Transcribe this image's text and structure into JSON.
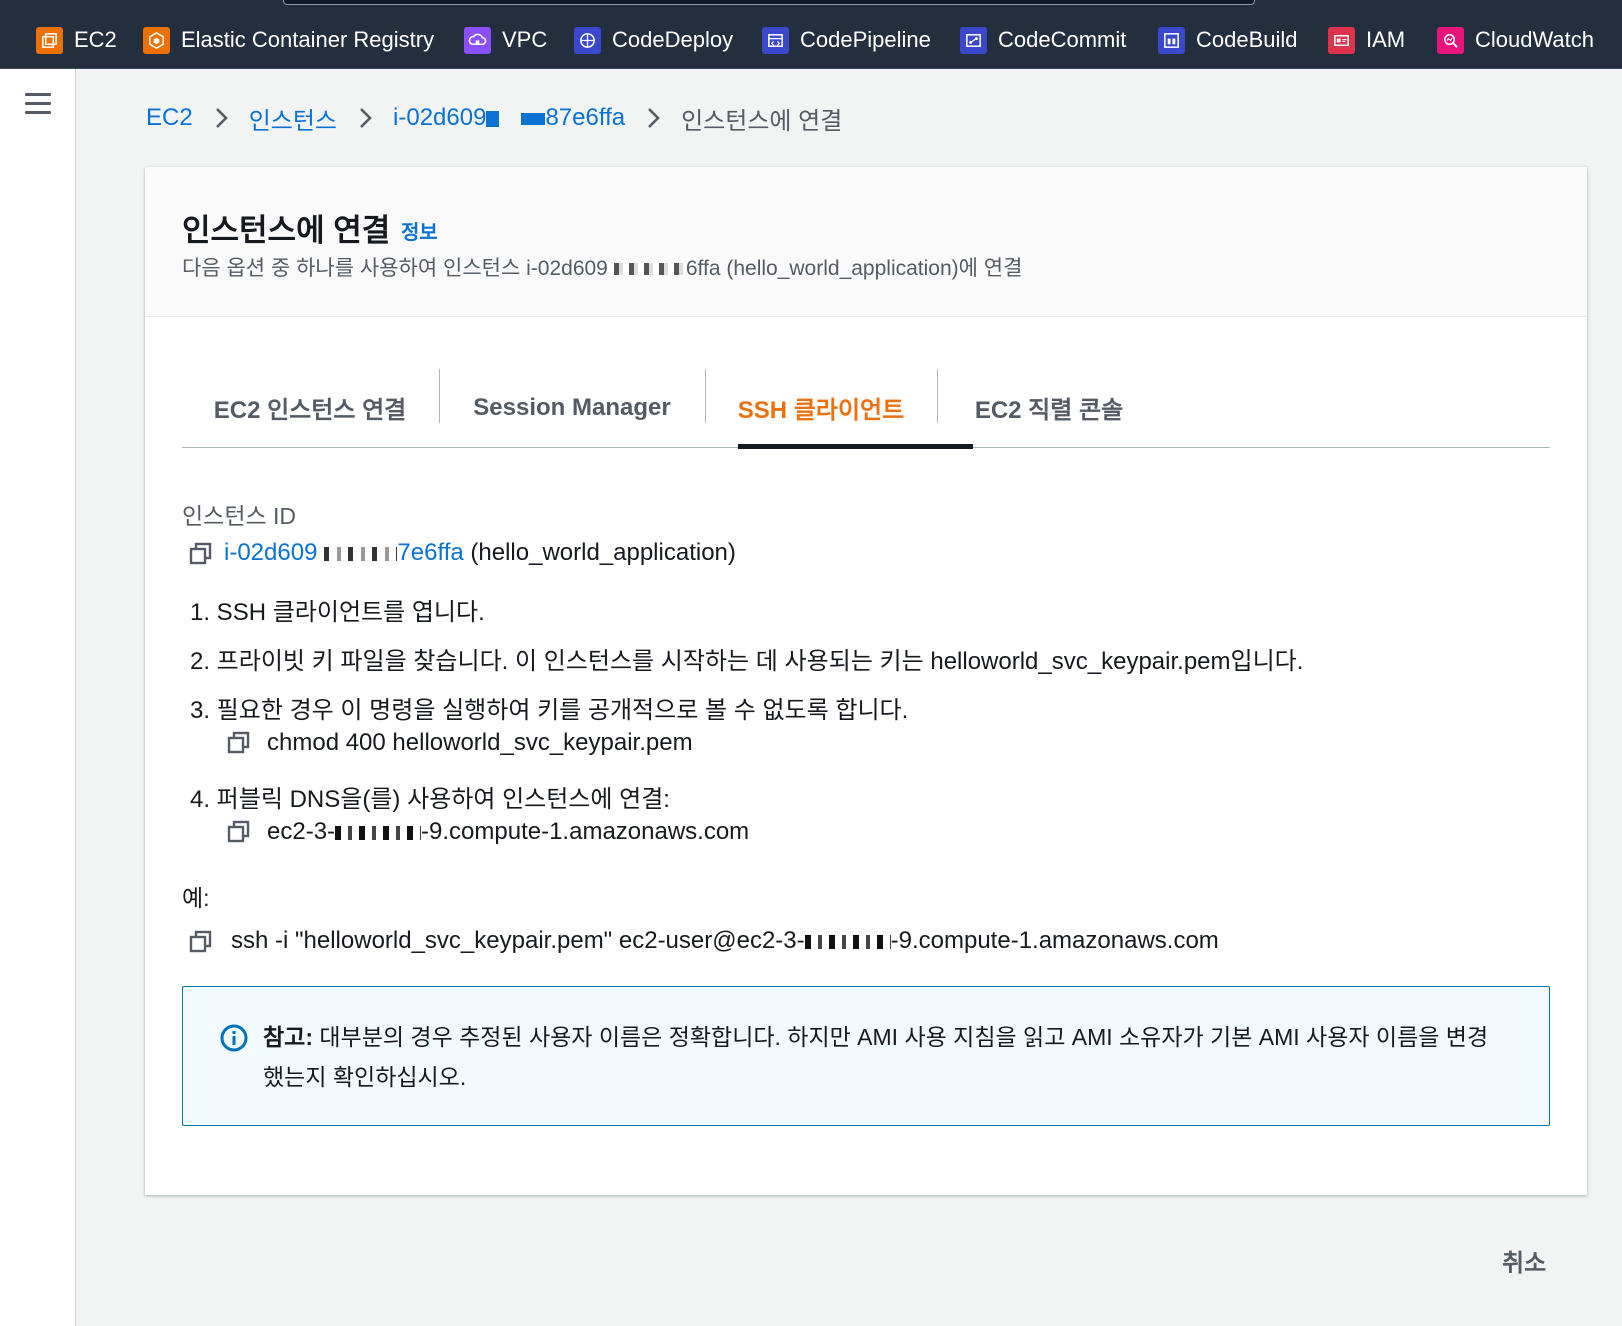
{
  "topbar": {
    "services": [
      {
        "label": "EC2",
        "color": "#ed7100",
        "icon": "ec2-icon"
      },
      {
        "label": "Elastic Container Registry",
        "color": "#ed7100",
        "icon": "container-registry-icon"
      },
      {
        "label": "VPC",
        "color": "#8c4fff",
        "icon": "vpc-icon"
      },
      {
        "label": "CodeDeploy",
        "color": "#3b48cc",
        "icon": "codedeploy-icon"
      },
      {
        "label": "CodePipeline",
        "color": "#3b48cc",
        "icon": "codepipeline-icon"
      },
      {
        "label": "CodeCommit",
        "color": "#3b48cc",
        "icon": "codecommit-icon"
      },
      {
        "label": "CodeBuild",
        "color": "#3b48cc",
        "icon": "codebuild-icon"
      },
      {
        "label": "IAM",
        "color": "#dd344c",
        "icon": "iam-icon"
      },
      {
        "label": "CloudWatch",
        "color": "#e7157b",
        "icon": "cloudwatch-icon"
      }
    ]
  },
  "breadcrumb": {
    "root": "EC2",
    "instances": "인스턴스",
    "instance_id_start": "i-02d609",
    "instance_id_end": "87e6ffa",
    "current": "인스턴스에 연결"
  },
  "header": {
    "title": "인스턴스에 연결",
    "info": "정보",
    "desc_prefix": "다음 옵션 중 하나를 사용하여 인스턴스 i-02d609",
    "desc_suffix": "6ffa (hello_world_application)에 연결"
  },
  "tabs": [
    {
      "label": "EC2 인스턴스 연결",
      "active": false
    },
    {
      "label": "Session Manager",
      "active": false
    },
    {
      "label": "SSH 클라이언트",
      "active": true
    },
    {
      "label": "EC2 직렬 콘솔",
      "active": false
    }
  ],
  "instance": {
    "label": "인스턴스 ID",
    "id_start": "i-02d609",
    "id_end": "7e6ffa",
    "name": "(hello_world_application)"
  },
  "steps": {
    "s1": "1. SSH 클라이언트를 엽니다.",
    "s2": "2. 프라이빗 키 파일을 찾습니다. 이 인스턴스를 시작하는 데 사용되는 키는 helloworld_svc_keypair.pem입니다.",
    "s3": "3. 필요한 경우 이 명령을 실행하여 키를 공개적으로 볼 수 없도록 합니다.",
    "s3_cmd": "chmod 400 helloworld_svc_keypair.pem",
    "s4": "4. 퍼블릭 DNS을(를) 사용하여 인스턴스에 연결:",
    "s4_dns_start": "ec2-3-",
    "s4_dns_end": "-9.compute-1.amazonaws.com"
  },
  "example": {
    "label": "예:",
    "cmd_start": "ssh -i \"helloworld_svc_keypair.pem\" ec2-user@ec2-3-",
    "cmd_end": "-9.compute-1.amazonaws.com"
  },
  "alert": {
    "bold": "참고:",
    "text": " 대부분의 경우 추정된 사용자 이름은 정확합니다. 하지만 AMI 사용 지침을 읽고 AMI 소유자가 기본 AMI 사용자 이름을 변경했는지 확인하십시오."
  },
  "footer": {
    "cancel": "취소"
  }
}
